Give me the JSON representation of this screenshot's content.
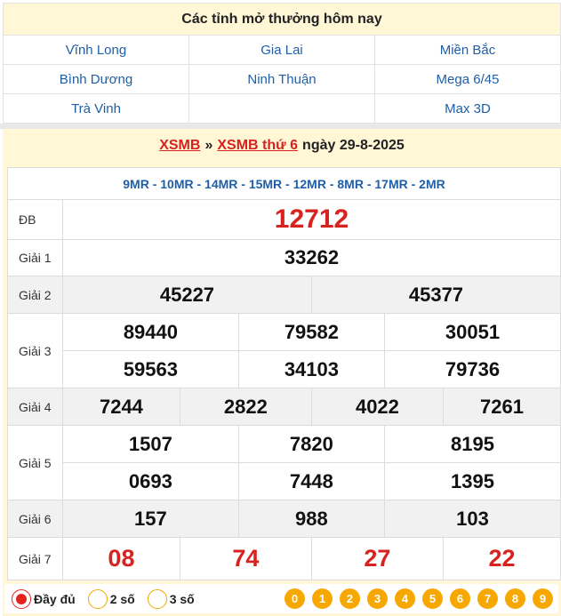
{
  "today": {
    "title": "Các tỉnh mở thưởng hôm nay",
    "cells": [
      "Vĩnh Long",
      "Gia Lai",
      "Miền Bắc",
      "Bình Dương",
      "Ninh Thuận",
      "Mega 6/45",
      "Trà Vinh",
      "",
      "Max 3D"
    ]
  },
  "result": {
    "crumb_1": "XSMB",
    "crumb_sep": "»",
    "crumb_2": "XSMB thứ 6",
    "date": "ngày 29-8-2025",
    "codes": "9MR - 10MR - 14MR - 15MR - 12MR - 8MR - 17MR - 2MR",
    "labels": {
      "db": "ĐB",
      "g1": "Giải 1",
      "g2": "Giải 2",
      "g3": "Giải 3",
      "g4": "Giải 4",
      "g5": "Giải 5",
      "g6": "Giải 6",
      "g7": "Giải 7"
    },
    "db": "12712",
    "g1": "33262",
    "g2": [
      "45227",
      "45377"
    ],
    "g3": [
      "89440",
      "79582",
      "30051",
      "59563",
      "34103",
      "79736"
    ],
    "g4": [
      "7244",
      "2822",
      "4022",
      "7261"
    ],
    "g5": [
      "1507",
      "7820",
      "8195",
      "0693",
      "7448",
      "1395"
    ],
    "g6": [
      "157",
      "988",
      "103"
    ],
    "g7": [
      "08",
      "74",
      "27",
      "22"
    ]
  },
  "controls": {
    "options": [
      "Đầy đủ",
      "2 số",
      "3 số"
    ],
    "digits": [
      "0",
      "1",
      "2",
      "3",
      "4",
      "5",
      "6",
      "7",
      "8",
      "9"
    ]
  },
  "colors": {
    "accent_red": "#d7221f",
    "link_blue": "#1f5fa8",
    "header_bg": "#fff7d6",
    "digit_orange": "#f6a800"
  }
}
